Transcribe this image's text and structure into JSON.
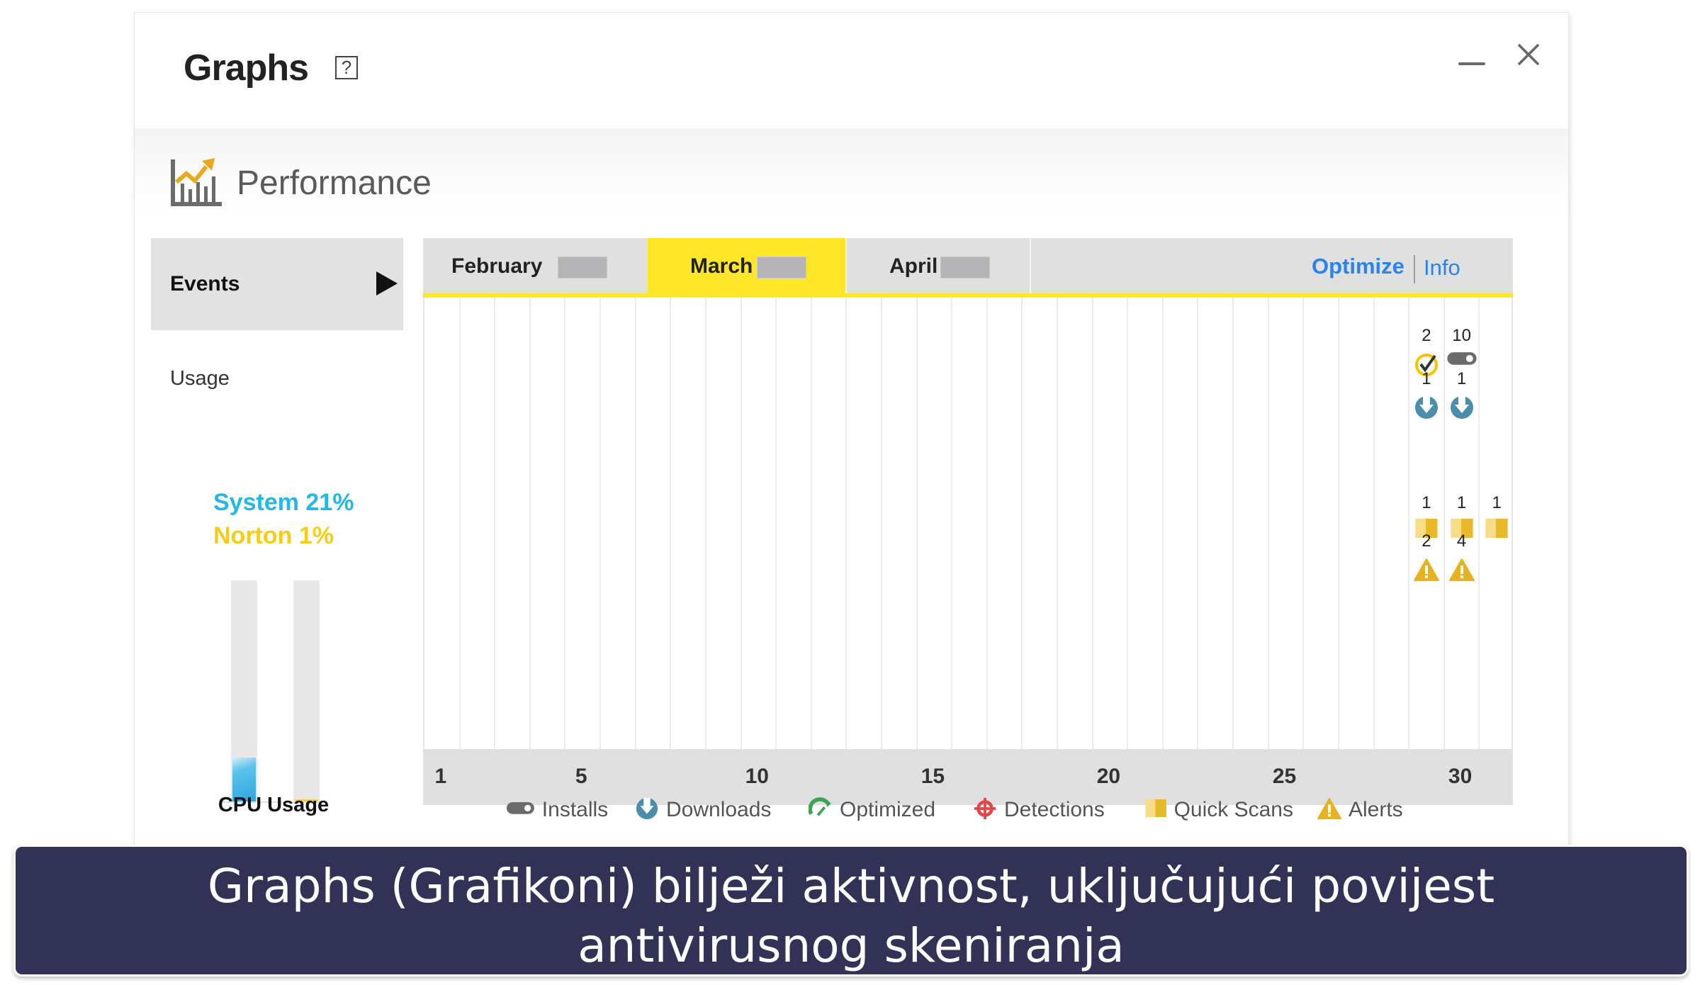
{
  "window": {
    "title": "Graphs",
    "help_label": "?",
    "section_title": "Performance"
  },
  "sidebar": {
    "events_label": "Events",
    "usage_label": "Usage",
    "system_usage": "System 21%",
    "norton_usage": "Norton 1%",
    "cpu_label": "CPU Usage",
    "system_percent": 21,
    "norton_percent": 1
  },
  "tabs": [
    {
      "label": "February",
      "active": false
    },
    {
      "label": "March",
      "active": true
    },
    {
      "label": "April",
      "active": false
    }
  ],
  "links": {
    "optimize": "Optimize",
    "info": "Info"
  },
  "colors": {
    "accent_yellow": "#ffe628",
    "link_blue": "#2a84e8",
    "system_cyan": "#25b7e6",
    "norton_yellow": "#f5cd14",
    "caption_bg": "#313256"
  },
  "chart_data": {
    "type": "table",
    "title": "Events — March",
    "x_days": 31,
    "xticks": [
      "1",
      "5",
      "10",
      "15",
      "20",
      "25",
      "30"
    ],
    "events": [
      {
        "day": 29,
        "type": "optimized",
        "count": 2
      },
      {
        "day": 30,
        "type": "installs",
        "count": 10
      },
      {
        "day": 29,
        "type": "downloads",
        "count": 1
      },
      {
        "day": 30,
        "type": "downloads",
        "count": 1
      },
      {
        "day": 29,
        "type": "quick_scans",
        "count": 1
      },
      {
        "day": 30,
        "type": "quick_scans",
        "count": 1
      },
      {
        "day": 31,
        "type": "quick_scans",
        "count": 1
      },
      {
        "day": 29,
        "type": "alerts",
        "count": 2
      },
      {
        "day": 30,
        "type": "alerts",
        "count": 4
      }
    ],
    "legend": [
      {
        "key": "installs",
        "label": "Installs",
        "icon": "toggle-pill-icon"
      },
      {
        "key": "downloads",
        "label": "Downloads",
        "icon": "download-circle-icon"
      },
      {
        "key": "optimized",
        "label": "Optimized",
        "icon": "gauge-icon"
      },
      {
        "key": "detections",
        "label": "Detections",
        "icon": "crosshair-icon"
      },
      {
        "key": "quick_scans",
        "label": "Quick Scans",
        "icon": "scan-block-icon"
      },
      {
        "key": "alerts",
        "label": "Alerts",
        "icon": "warning-icon"
      }
    ]
  },
  "caption": {
    "line1": "Graphs (Grafikoni) bilježi aktivnost, uključujući povijest",
    "line2": "antivirusnog skeniranja"
  }
}
